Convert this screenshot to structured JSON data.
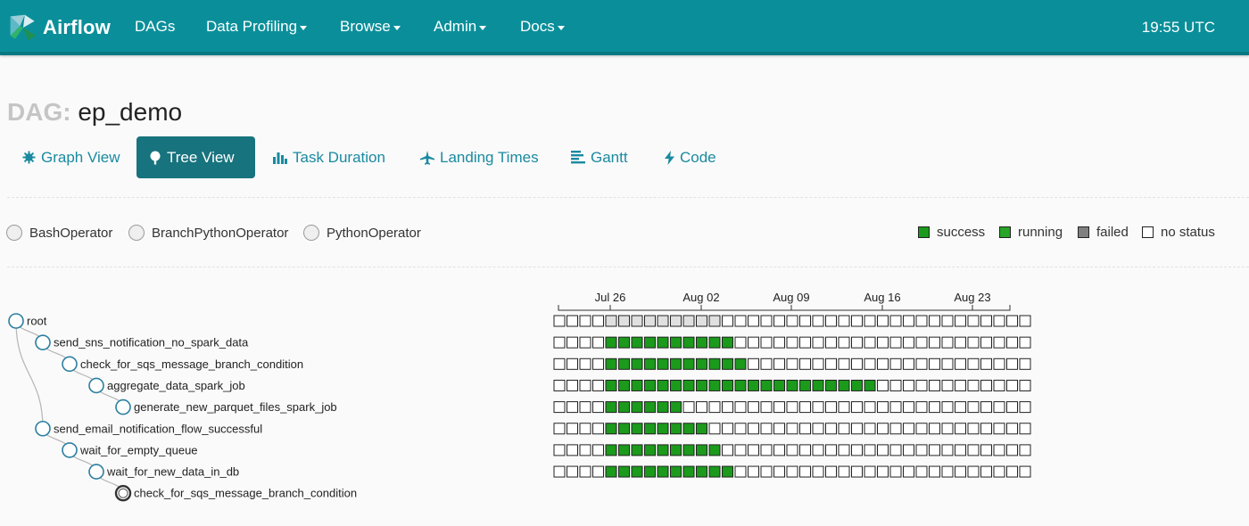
{
  "navbar": {
    "brand": "Airflow",
    "items": [
      {
        "label": "DAGs",
        "caret": false
      },
      {
        "label": "Data Profiling",
        "caret": true
      },
      {
        "label": "Browse",
        "caret": true
      },
      {
        "label": "Admin",
        "caret": true
      },
      {
        "label": "Docs",
        "caret": true
      }
    ],
    "clock": "19:55 UTC"
  },
  "page": {
    "title_prefix": "DAG:",
    "title_name": "ep_demo"
  },
  "tabs": [
    {
      "label": "Graph View",
      "icon": "graph-icon",
      "active": false
    },
    {
      "label": "Tree View",
      "icon": "tree-icon",
      "active": true
    },
    {
      "label": "Task Duration",
      "icon": "bar-chart-icon",
      "active": false
    },
    {
      "label": "Landing Times",
      "icon": "plane-icon",
      "active": false
    },
    {
      "label": "Gantt",
      "icon": "gantt-icon",
      "active": false
    },
    {
      "label": "Code",
      "icon": "bolt-icon",
      "active": false
    }
  ],
  "operators": [
    "BashOperator",
    "BranchPythonOperator",
    "PythonOperator"
  ],
  "states": [
    {
      "label": "success",
      "color": "#1b9a1b"
    },
    {
      "label": "running",
      "color": "#26a526"
    },
    {
      "label": "failed",
      "color": "#808080"
    },
    {
      "label": "no status",
      "color": "#ffffff"
    }
  ],
  "timeline": {
    "ticks": [
      "Jul 26",
      "Aug 02",
      "Aug 09",
      "Aug 16",
      "Aug 23"
    ]
  },
  "colors": {
    "success": "#1b9a1b",
    "skipped": "#e0e0e0",
    "none": "#ffffff",
    "accent": "#0a8f9a"
  },
  "tree": {
    "nodes": [
      {
        "label": "root",
        "depth": 0,
        "current": false
      },
      {
        "label": "send_sns_notification_no_spark_data",
        "depth": 1,
        "current": false
      },
      {
        "label": "check_for_sqs_message_branch_condition",
        "depth": 2,
        "current": false
      },
      {
        "label": "aggregate_data_spark_job",
        "depth": 3,
        "current": false
      },
      {
        "label": "generate_new_parquet_files_spark_job",
        "depth": 4,
        "current": false
      },
      {
        "label": "send_email_notification_flow_successful",
        "depth": 1,
        "current": false
      },
      {
        "label": "wait_for_empty_queue",
        "depth": 2,
        "current": false
      },
      {
        "label": "wait_for_new_data_in_db",
        "depth": 3,
        "current": false
      },
      {
        "label": "check_for_sqs_message_branch_condition",
        "depth": 4,
        "current": true
      }
    ],
    "runs": [
      "nnnnsssssssssnnnnnnnnnnnnnnnnnnnnnnnn",
      "nnnnggggggggggnnnnnnnnnnnnnnnnnnnnnnn",
      "nnnngggggggggggnnnnnnnnnnnnnnnnnnnnnn",
      "nnnngggggggggggggggggggggnnnnnnnnnnnn",
      "nnnnggggggnnnnnnnnnnnnnnnnnnnnnnnnnnn",
      "nnnnggggggggnnnnnnnnnnnnnnnnnnnnnnnnn",
      "nnnngggggggggnnnnnnnnnnnnnnnnnnnnnnnn",
      "nnnnggggggggggnnnnnnnnnnnnnnnnnnnnnnn"
    ]
  }
}
